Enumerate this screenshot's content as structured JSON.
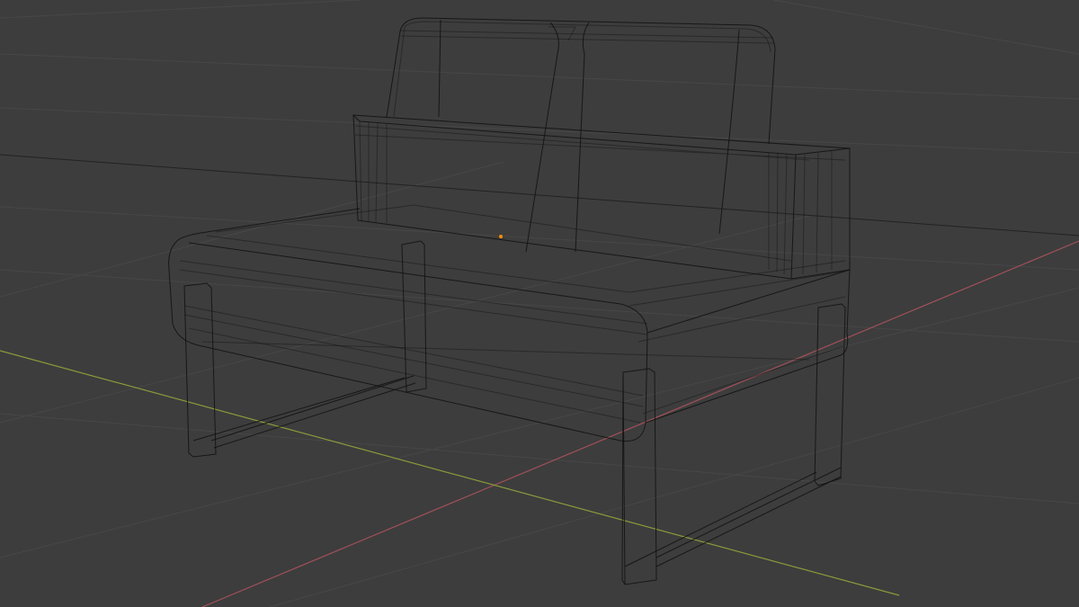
{
  "viewport": {
    "background_color": "#3d3d3d",
    "grid_color": "#474747",
    "x_axis_color": "#a0505a",
    "y_axis_color": "#8a9a3a",
    "wireframe_color": "#111111",
    "origin_color": "#ff8c00"
  },
  "scene": {
    "object": "sofa-chair",
    "display_mode": "wireframe"
  }
}
